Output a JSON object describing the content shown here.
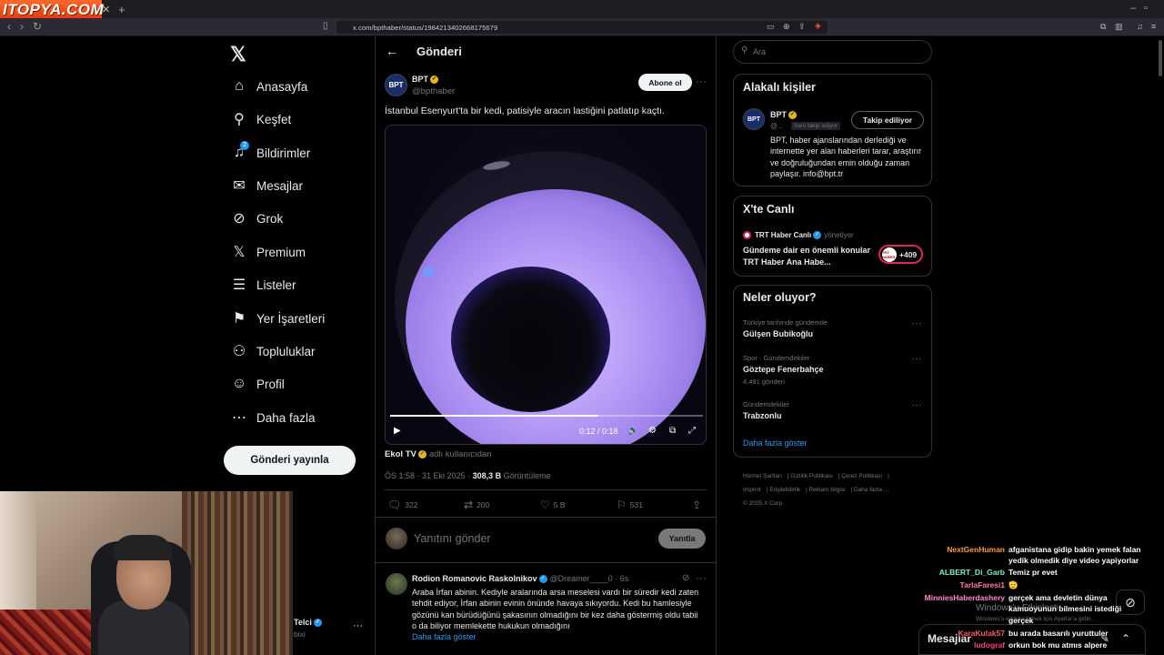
{
  "browser": {
    "tab_logo_text": "ITOPYA.COM",
    "url": "x.com/bpthaber/status/1984213402668175679"
  },
  "nav": {
    "items": [
      {
        "label": "Anasayfa",
        "icon": "home-icon"
      },
      {
        "label": "Keşfet",
        "icon": "search-icon"
      },
      {
        "label": "Bildirimler",
        "icon": "bell-icon",
        "badge": "2"
      },
      {
        "label": "Mesajlar",
        "icon": "mail-icon"
      },
      {
        "label": "Grok",
        "icon": "grok-icon"
      },
      {
        "label": "Premium",
        "icon": "x-icon"
      },
      {
        "label": "Listeler",
        "icon": "list-icon"
      },
      {
        "label": "Yer İşaretleri",
        "icon": "bookmark-icon"
      },
      {
        "label": "Topluluklar",
        "icon": "communities-icon"
      },
      {
        "label": "Profil",
        "icon": "person-icon"
      },
      {
        "label": "Daha fazla",
        "icon": "more-circle-icon"
      }
    ],
    "post_button": "Gönderi yayınla",
    "account": {
      "name": "Telci",
      "handle": "bixi"
    }
  },
  "post": {
    "header_title": "Gönderi",
    "author_name": "BPT",
    "author_handle": "@bpthaber",
    "follow_label": "Abone ol",
    "text": "İstanbul Esenyurt'ta bir kedi, patisiyle aracın lastiğini patlatıp kaçtı.",
    "video": {
      "time": "0:12 / 0:18",
      "progress": 0.667
    },
    "source_name": "Ekol TV",
    "source_suffix": "adlı kullanıcıdan",
    "meta_time": "ÖS 1:58 · 31 Eki 2025 ·",
    "meta_views": "308,3 B",
    "meta_views_label": "Görüntüleme",
    "actions": {
      "replies": "322",
      "reposts": "200",
      "likes": "5 B",
      "bookmarks": "531"
    },
    "reply_placeholder": "Yanıtını gönder",
    "reply_button": "Yanıtla"
  },
  "comment": {
    "name": "Rodion Romanovic Raskolnikov",
    "handle": "@Dreamer____0 · 6s",
    "text": "Araba İrfan abinin. Kediyle aralarında arsa meselesi vardı bir süredir kedi zaten tehdit ediyor, İrfan abinin evinin önünde havaya sıkıyordu. Kedi bu hamlesiyle gözünü kan bürüdüğünü şakasının olmadığını bir kez daha göstermiş oldu tabii o da biliyor memlekette hukukun olmadığını",
    "show_more": "Daha fazla göster"
  },
  "sidebar": {
    "search_placeholder": "Ara",
    "related": {
      "title": "Alakalı kişiler",
      "name": "BPT",
      "handle": "@...",
      "tag": "Seni takip ediyor",
      "follow_label": "Takip ediliyor",
      "bio": "BPT, haber ajanslarından derlediği ve internette yer alan haberleri tarar, araştırır ve doğruluğundan emin olduğu zaman paylaşır. info@bpt.tr"
    },
    "live": {
      "title": "X'te Canlı",
      "host": "TRT Haber Canlı",
      "role": "yönetiyor",
      "text": "Gündeme dair en önemli konular TRT Haber Ana Habe...",
      "count": "+409",
      "badge_text": "TRT HABER"
    },
    "trends": {
      "title": "Neler oluyor?",
      "items": [
        {
          "category": "Türkiye tarihinde gündemde",
          "name": "Gülşen Bubikoğlu",
          "count": ""
        },
        {
          "category": "Spor · Gündemdekiler",
          "name": "Göztepe Fenerbahçe",
          "count": "4.491 gönderi"
        },
        {
          "category": "Gündemdekiler",
          "name": "Trabzonlu",
          "count": ""
        }
      ],
      "show_more": "Daha fazla göster"
    },
    "footer": [
      "Hizmet Şartları",
      "Gizlilik Politikası",
      "Çerez Politikası",
      "Imprint",
      "Erişilebilirlik",
      "Reklam bilgisi",
      "Daha fazla ...",
      "© 2025 X Corp."
    ]
  },
  "chat": [
    {
      "user": "NextGenHuman",
      "color": "#ff9a2e",
      "msg": "afganistana gidip bakin yemek falan"
    },
    {
      "user": "",
      "color": "#ffffff",
      "msg": "yedik olmedik diye video yapiyorlar"
    },
    {
      "user": "ALBERT_Di_Garb",
      "color": "#7cf0c8",
      "msg": "Temiz pr evet"
    },
    {
      "user": "TarlaFaresi1",
      "color": "#ff7ab0",
      "msg": "🫡"
    },
    {
      "user": "MinniesHaberdashery",
      "color": "#ff8ad0",
      "msg": "gerçek ama devletin dünya"
    },
    {
      "user": "",
      "color": "#ffffff",
      "msg": "kamuoyunun bilmesini istediği"
    },
    {
      "user": "",
      "color": "#ffffff",
      "msg": "gerçek"
    },
    {
      "user": "KaraKulak57",
      "color": "#ff5a5a",
      "msg": "bu arada basarılı yuruttuler"
    },
    {
      "user": "ludograf",
      "color": "#ff3a7a",
      "msg": "orkun bok mu atmıs alpere"
    }
  ],
  "windows_watermark": {
    "line1": "Windows'u Etkinleştir",
    "line2": "Windows'u etkinleştirmek için Ayarlar'a gidin."
  },
  "messages_bar": {
    "title": "Mesajlar"
  },
  "colors": {
    "accent": "#1d9bf0",
    "background": "#000000",
    "border": "#2f3336",
    "muted": "#71767b",
    "live": "#e0245e",
    "verified_gold": "#e2b719"
  }
}
